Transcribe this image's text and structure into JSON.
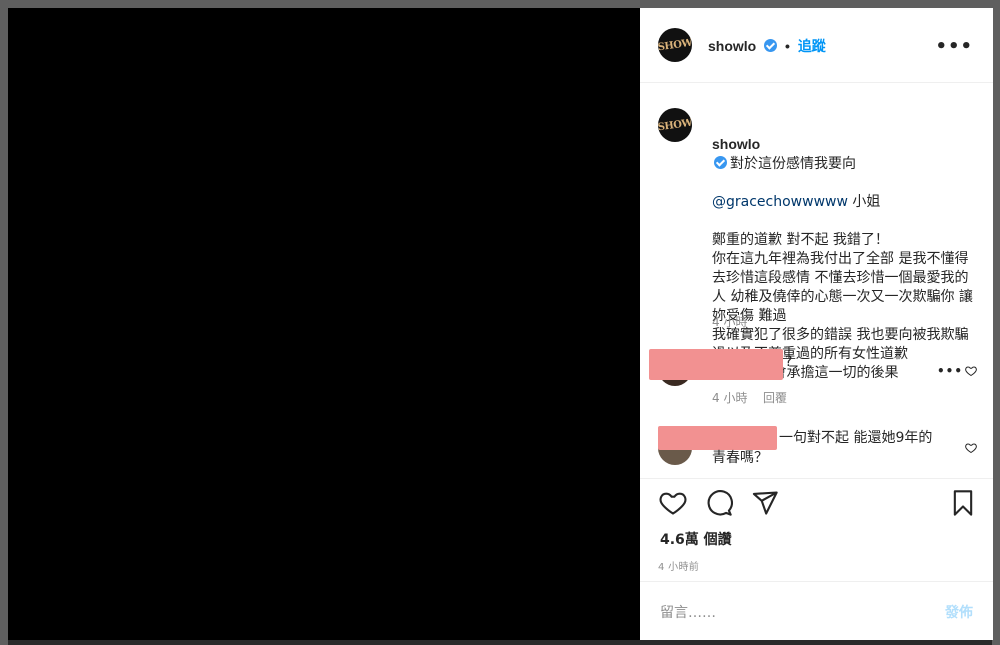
{
  "post": {
    "username": "showlo",
    "follow_label": "追蹤",
    "dot": "•",
    "more_label": "•••",
    "avatar_text": "SHOW"
  },
  "caption": {
    "username": "showlo",
    "line1": "對於這份感情我要向",
    "mention": "@gracechowwwww",
    "line2_suffix": " 小姐",
    "body": "鄭重的道歉 對不起 我錯了！\n你在這九年裡為我付出了全部 是我不懂得去珍惜這段感情 不懂去珍惜一個最愛我的人 幼稚及僥倖的心態一次又一次欺騙你 讓妳受傷 難過\n我確實犯了很多的錯誤 我也要向被我欺騙過以及不尊重過的所有女性道歉\n對不起 我會承擔這一切的後果",
    "time": "4 小時"
  },
  "comments": [
    {
      "text": "?",
      "time": "4 小時",
      "reply_label": "回覆",
      "more_label": "•••"
    },
    {
      "text_line1": "一句對不起 能還她9年的",
      "text_line2": "青春嗎？"
    }
  ],
  "actions": {
    "likes": "4.6萬 個讚",
    "time_ago": "4 小時前"
  },
  "composer": {
    "placeholder": "留言……",
    "post_label": "發佈"
  },
  "colors": {
    "verified": "#3897f0",
    "follow": "#0095f6",
    "redaction": "#f29191",
    "post_disabled": "#b2dffc"
  }
}
